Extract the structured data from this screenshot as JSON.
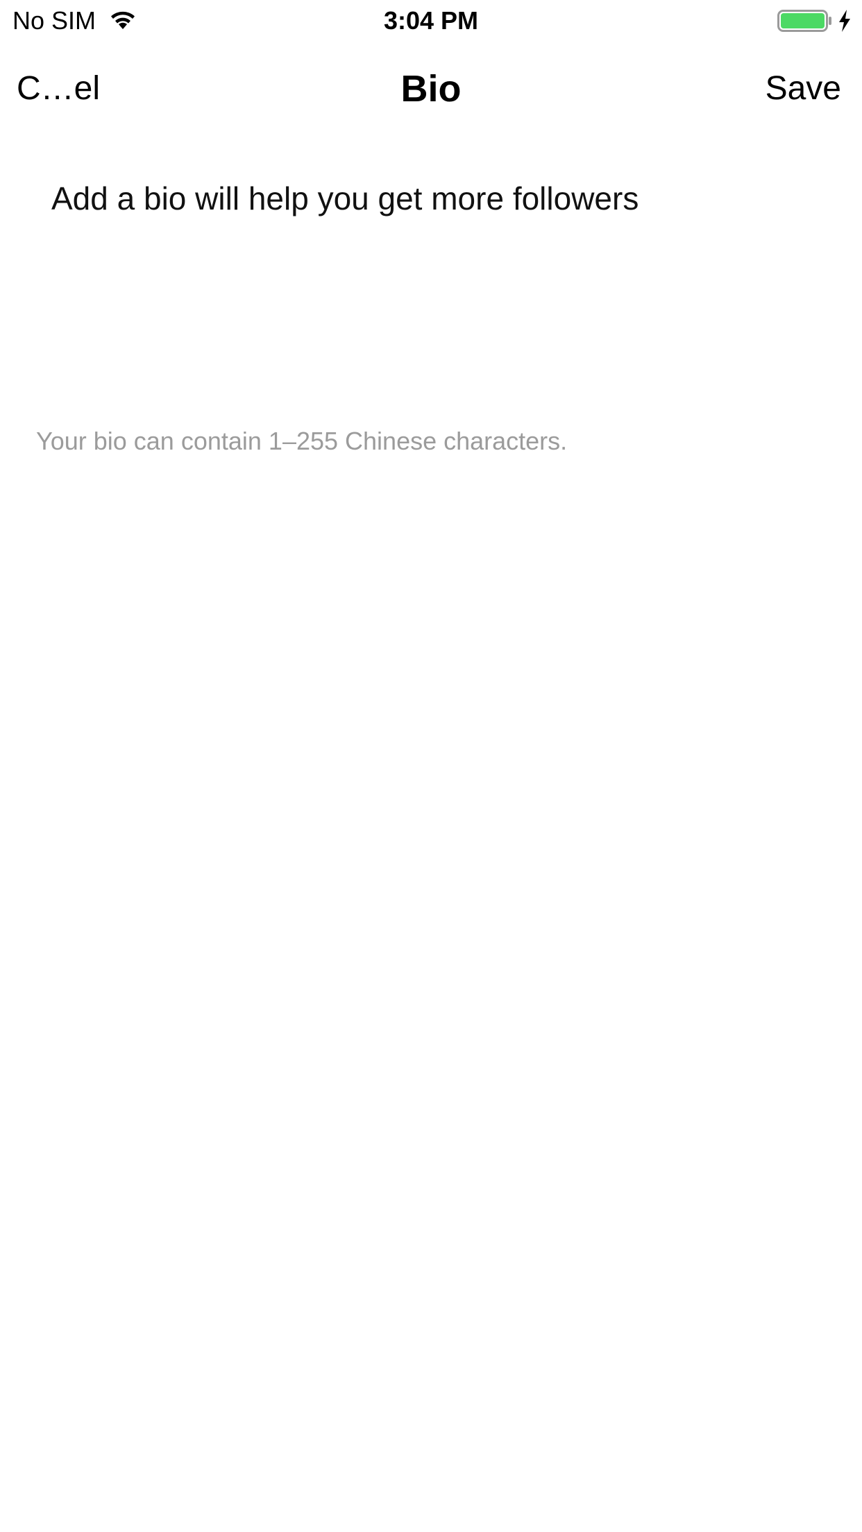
{
  "status_bar": {
    "carrier": "No SIM",
    "time": "3:04 PM",
    "battery_color": "#4cd964",
    "wifi_icon": "wifi-icon",
    "battery_icon": "battery-icon",
    "charging_icon": "charging-bolt-icon"
  },
  "nav": {
    "cancel_label": "C…el",
    "title": "Bio",
    "save_label": "Save"
  },
  "bio": {
    "placeholder": "Add a bio will help you get more followers",
    "value": ""
  },
  "hint": {
    "text": "Your bio can contain 1–255 Chinese characters."
  }
}
